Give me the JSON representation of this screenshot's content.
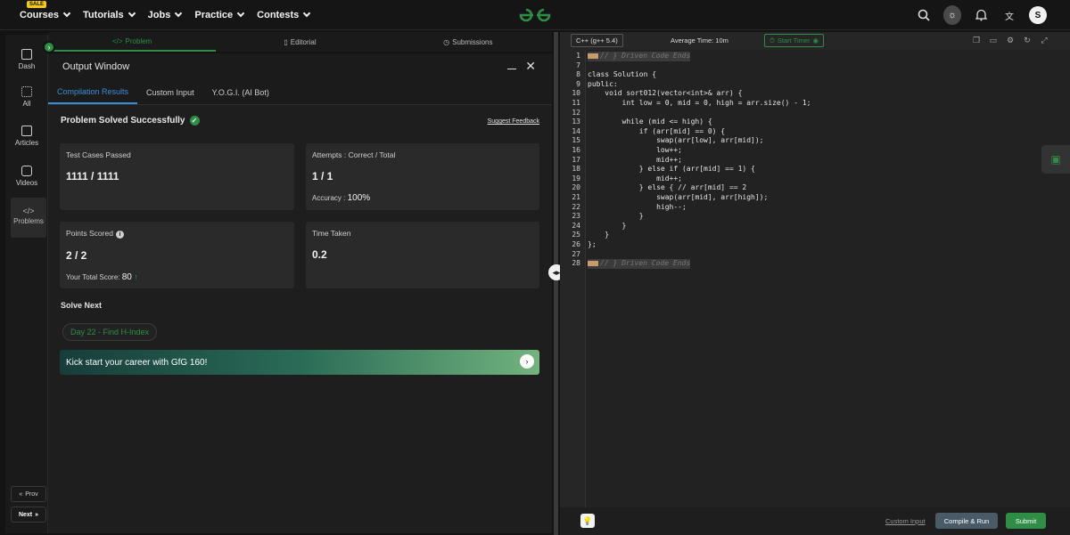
{
  "nav": {
    "items": [
      {
        "label": "Courses",
        "badge": "SALE"
      },
      {
        "label": "Tutorials"
      },
      {
        "label": "Jobs"
      },
      {
        "label": "Practice"
      },
      {
        "label": "Contests"
      }
    ],
    "right_icons": [
      "search-icon",
      "theme-toggle-icon",
      "bell-icon",
      "translate-icon"
    ],
    "avatar_letter": "S",
    "brand_color": "#2f8d46"
  },
  "sidebar": {
    "items": [
      {
        "label": "Dash",
        "icon": "dash-icon"
      },
      {
        "label": "All",
        "icon": "grid-icon"
      },
      {
        "label": "Articles",
        "icon": "book-icon"
      },
      {
        "label": "Videos",
        "icon": "video-icon"
      },
      {
        "label": "Problems",
        "icon": "code-icon"
      }
    ],
    "prev": "Prov",
    "next": "Next"
  },
  "problem_tabs": [
    "Problem",
    "Editorial",
    "Submissions"
  ],
  "output": {
    "title": "Output Window",
    "tabs": [
      "Compilation Results",
      "Custom Input",
      "Y.O.G.I. (AI Bot)"
    ],
    "status": "Problem Solved Successfully",
    "feedback": "Suggest Feedback",
    "test_cases_label": "Test Cases Passed",
    "test_cases_value": "1111 / 1111",
    "attempts_label": "Attempts : Correct / Total",
    "attempts_value": "1 / 1",
    "accuracy_label": "Accuracy :",
    "accuracy_value": "100%",
    "points_label": "Points Scored",
    "points_value": "2 / 2",
    "total_score_label": "Your Total Score:",
    "total_score_value": "80",
    "time_label": "Time Taken",
    "time_value": "0.2",
    "solve_next": "Solve Next",
    "next_problem": "Day 22 - Find H-Index",
    "banner": "Kick start your career with GfG 160!"
  },
  "editor": {
    "language": "C++ (g++ 5.4)",
    "avg_time": "Average Time: 10m",
    "timer": "Start Timer",
    "lines": [
      {
        "n": "1",
        "text": "// } Driven Code Ends",
        "comment": true,
        "folded": true
      },
      {
        "n": "7",
        "text": ""
      },
      {
        "n": "8",
        "text": "class Solution {"
      },
      {
        "n": "9",
        "text": "public:"
      },
      {
        "n": "10",
        "text": "    void sort012(vector<int>& arr) {"
      },
      {
        "n": "11",
        "text": "        int low = 0, mid = 0, high = arr.size() - 1;"
      },
      {
        "n": "12",
        "text": ""
      },
      {
        "n": "13",
        "text": "        while (mid <= high) {"
      },
      {
        "n": "14",
        "text": "            if (arr[mid] == 0) {"
      },
      {
        "n": "15",
        "text": "                swap(arr[low], arr[mid]);"
      },
      {
        "n": "16",
        "text": "                low++;"
      },
      {
        "n": "17",
        "text": "                mid++;"
      },
      {
        "n": "18",
        "text": "            } else if (arr[mid] == 1) {"
      },
      {
        "n": "19",
        "text": "                mid++;"
      },
      {
        "n": "20",
        "text": "            } else { // arr[mid] == 2"
      },
      {
        "n": "21",
        "text": "                swap(arr[mid], arr[high]);"
      },
      {
        "n": "22",
        "text": "                high--;"
      },
      {
        "n": "23",
        "text": "            }"
      },
      {
        "n": "24",
        "text": "        }"
      },
      {
        "n": "25",
        "text": "    }"
      },
      {
        "n": "26",
        "text": "};"
      },
      {
        "n": "27",
        "text": ""
      },
      {
        "n": "28",
        "text": "// } Driven Code Ends",
        "comment": true,
        "folded": true
      }
    ],
    "custom_input": "Custom Input",
    "compile_run": "Compile & Run",
    "submit": "Submit"
  }
}
